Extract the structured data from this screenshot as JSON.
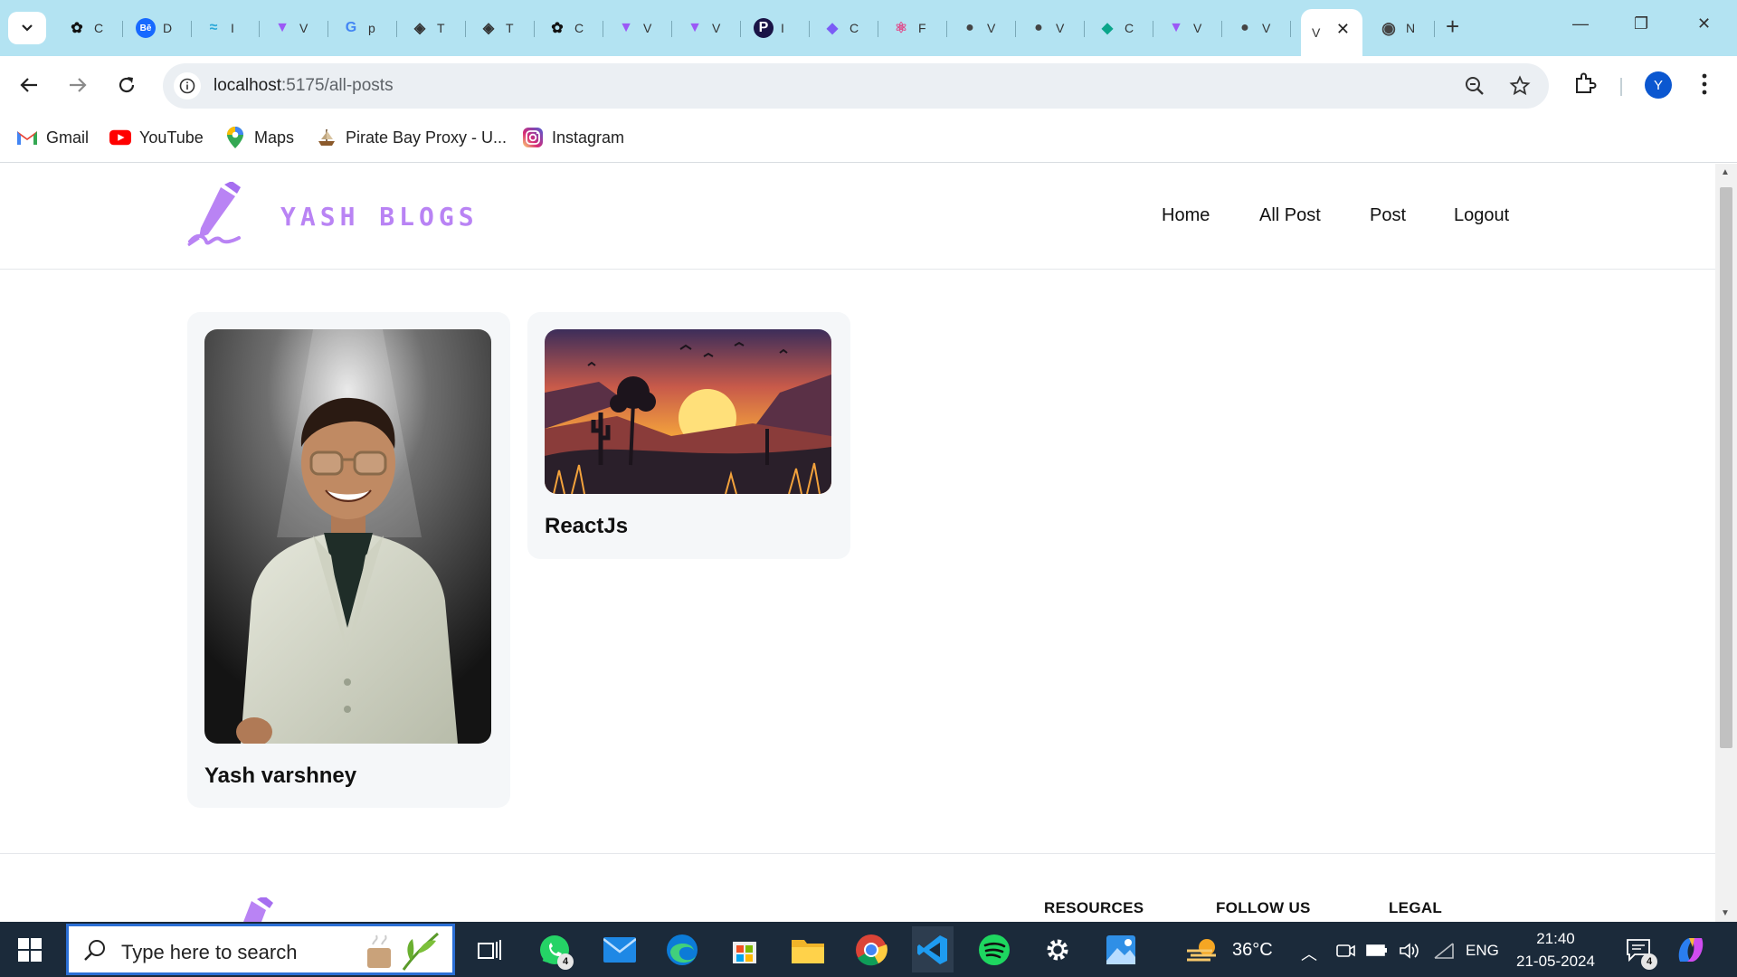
{
  "browser": {
    "tabs": [
      {
        "icon": "openai-icon",
        "label": "C",
        "color": "#111111"
      },
      {
        "icon": "behance-icon",
        "label": "D",
        "color": "#1769ff"
      },
      {
        "icon": "wave-icon",
        "label": "I",
        "color": "#2aa8d8"
      },
      {
        "icon": "vite-icon",
        "label": "V",
        "color": "#9b59f6"
      },
      {
        "icon": "google-icon",
        "label": "p",
        "color": "#4285f4"
      },
      {
        "icon": "layers-icon",
        "label": "T",
        "color": "#333333"
      },
      {
        "icon": "layers-icon",
        "label": "T",
        "color": "#333333"
      },
      {
        "icon": "openai-icon",
        "label": "C",
        "color": "#111111"
      },
      {
        "icon": "vite-icon",
        "label": "V",
        "color": "#9b59f6"
      },
      {
        "icon": "vite-icon",
        "label": "V",
        "color": "#9b59f6"
      },
      {
        "icon": "p-circle-icon",
        "label": "I",
        "color": "#1a1446"
      },
      {
        "icon": "copilot-icon",
        "label": "C",
        "color": "#7b5cf6"
      },
      {
        "icon": "react-icon",
        "label": "F",
        "color": "#e04a8a"
      },
      {
        "icon": "globe-icon",
        "label": "V",
        "color": "#444444"
      },
      {
        "icon": "globe-icon",
        "label": "V",
        "color": "#444444"
      },
      {
        "icon": "diamond-icon",
        "label": "C",
        "color": "#0aa58a"
      },
      {
        "icon": "vite-icon",
        "label": "V",
        "color": "#9b59f6"
      },
      {
        "icon": "globe-icon",
        "label": "V",
        "color": "#444444"
      },
      {
        "icon": "none",
        "label": "V",
        "color": "#ffffff"
      },
      {
        "icon": "chrome-icon",
        "label": "N",
        "color": "#444444"
      }
    ],
    "active_tab_close": "✕",
    "new_tab": "+",
    "url_host": "localhost",
    "url_path": ":5175/all-posts",
    "profile_letter": "Y",
    "bookmarks": [
      {
        "icon": "gmail-icon",
        "label": "Gmail"
      },
      {
        "icon": "youtube-icon",
        "label": "YouTube"
      },
      {
        "icon": "maps-icon",
        "label": "Maps"
      },
      {
        "icon": "ship-icon",
        "label": "Pirate Bay Proxy - U..."
      },
      {
        "icon": "instagram-icon",
        "label": "Instagram"
      }
    ]
  },
  "site": {
    "logo_text": "YASH BLOGS",
    "nav": [
      "Home",
      "All Post",
      "Post",
      "Logout"
    ],
    "posts": [
      {
        "title": "Yash varshney",
        "image": "portrait-photo"
      },
      {
        "title": "ReactJs",
        "image": "desert-sunset-illustration"
      }
    ],
    "footer_headings": [
      "RESOURCES",
      "FOLLOW US",
      "LEGAL"
    ]
  },
  "taskbar": {
    "search_placeholder": "Type here to search",
    "whatsapp_badge": "4",
    "weather_temp": "36°C",
    "language": "ENG",
    "time": "21:40",
    "date": "21-05-2024",
    "notification_badge": "4"
  },
  "colors": {
    "accent_purple": "#b983f4",
    "tabbar_bg": "#b3e3f2",
    "taskbar_bg": "#1b2a3a",
    "card_bg": "#f5f7f9"
  }
}
